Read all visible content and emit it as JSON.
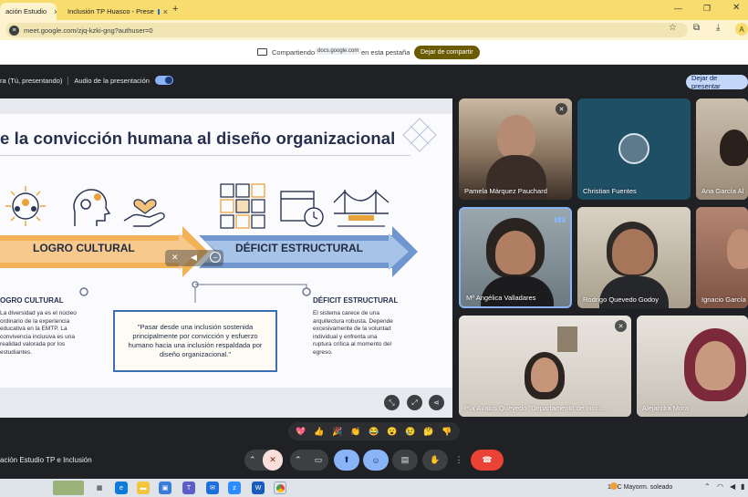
{
  "browser": {
    "tabs": [
      {
        "label": "ación Estudio",
        "active": true
      },
      {
        "label": "Inclusión TP Huasco - Prese",
        "active": false
      }
    ],
    "new_tab": "+",
    "url": "meet.google.com/zjq-kzki-gng?authuser=0",
    "profile_initial": "A"
  },
  "sharebar": {
    "prefix": "Compartiendo",
    "domain": "docs.google.com",
    "suffix": "en esta pestaña",
    "stop_label": "Dejar de compartir"
  },
  "meet": {
    "presenter_label": "ra (Tú, presentando)",
    "audio_label": "Audio de la presentación",
    "stop_presenting": "Dejar de presentar",
    "meeting_name": "ación Estudio TP e Inclusión"
  },
  "slide": {
    "title": "e la convicción humana al diseño organizacional",
    "left_arrow": "LOGRO CULTURAL",
    "right_arrow": "DÉFICIT ESTRUCTURAL",
    "left_head": "OGRO CULTURAL",
    "left_body": [
      "La diversidad ya es el núcleo",
      "ordinario de la experiencia",
      "educativa en la EMTP. La",
      "convivencia inclusiva es una",
      "realidad valorada por los",
      "estudiantes."
    ],
    "quote": "\"Pasar desde una inclusión sostenida principalmente por convicción y esfuerzo humano hacia una inclusión respaldada por diseño organizacional.\"",
    "right_head": "DÉFICIT ESTRUCTURAL",
    "right_body": [
      "El sistema carece de una",
      "arquitectura robusta. Depende",
      "excesivamente de la voluntad",
      "individual y enfrenta una",
      "ruptura crítica al momento del",
      "egreso."
    ]
  },
  "participants": [
    {
      "name": "Pamela Márquez Pauchard",
      "muted": true
    },
    {
      "name": "Christian Fuentes",
      "muted": false
    },
    {
      "name": "Ana García Al",
      "muted": false
    },
    {
      "name": "Mª Angélica Valladares",
      "muted": false,
      "speaking": true
    },
    {
      "name": "Rodrigo Quevedo Godoy",
      "muted": false
    },
    {
      "name": "Ignacio García",
      "muted": false
    },
    {
      "name": "Pía Ávalos Quevedo \"Departamento de Inclu...",
      "muted": false
    },
    {
      "name": "Alejandra Mora",
      "muted": true
    }
  ],
  "reactions": [
    "💖",
    "👍",
    "🎉",
    "👏",
    "😂",
    "😮",
    "😢",
    "🤔",
    "👎"
  ],
  "taskbar": {
    "weather": "14°C  Mayorm. soleado"
  },
  "colors": {
    "meet_bg": "#202124",
    "tab_bar": "#f8dc6e",
    "end_call": "#ea4335",
    "accent": "#8ab4f8"
  }
}
